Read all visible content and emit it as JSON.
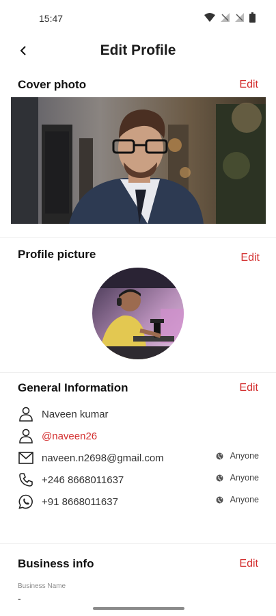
{
  "status_bar": {
    "time": "15:47"
  },
  "header": {
    "title": "Edit Profile"
  },
  "cover": {
    "title": "Cover photo",
    "edit_label": "Edit"
  },
  "profile_picture": {
    "title": "Profile picture",
    "edit_label": "Edit"
  },
  "general": {
    "title": "General Information",
    "edit_label": "Edit",
    "name": "Naveen kumar",
    "handle": "@naveen26",
    "email": "naveen.n2698@gmail.com",
    "email_visibility": "Anyone",
    "phone": "+246 8668011637",
    "phone_visibility": "Anyone",
    "whatsapp": "+91 8668011637",
    "whatsapp_visibility": "Anyone"
  },
  "business": {
    "title": "Business info",
    "edit_label": "Edit",
    "name_label": "Business Name",
    "name_value": "-"
  },
  "colors": {
    "accent": "#d32f2f",
    "text": "#1b1b1b",
    "muted": "#8a8a8a"
  },
  "icons": [
    "back-arrow-icon",
    "wifi-icon",
    "signal-icon",
    "battery-icon",
    "user-icon",
    "mail-icon",
    "phone-icon",
    "whatsapp-icon",
    "globe-icon"
  ]
}
